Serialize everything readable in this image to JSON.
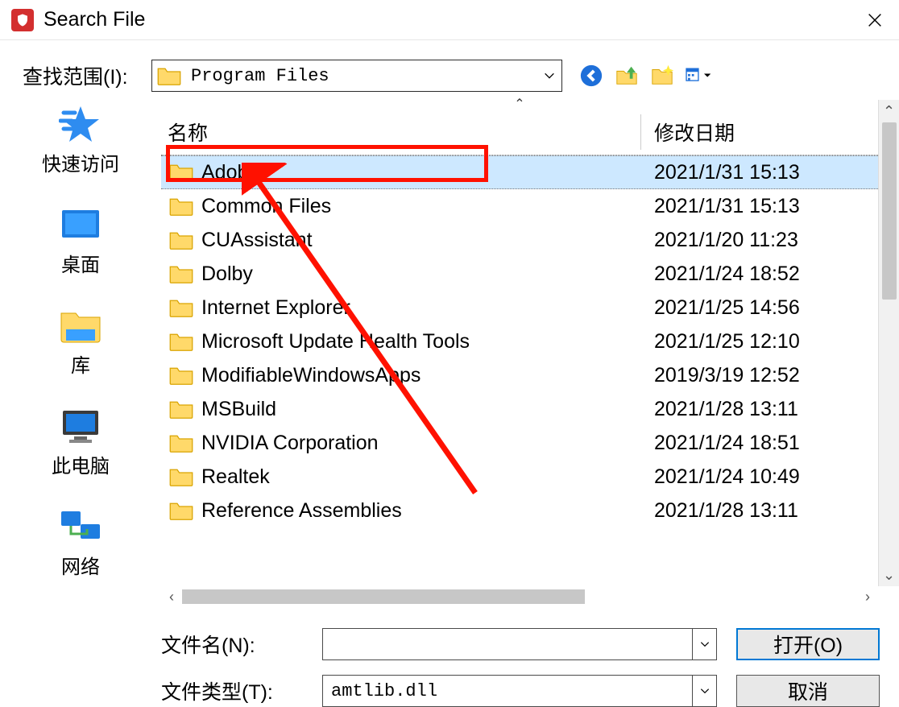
{
  "title": "Search File",
  "range_label": "查找范围(I):",
  "path": "Program Files",
  "headers": {
    "name": "名称",
    "date": "修改日期"
  },
  "files": [
    {
      "name": "Adobe",
      "date": "2021/1/31 15:13",
      "selected": true
    },
    {
      "name": "Common Files",
      "date": "2021/1/31 15:13"
    },
    {
      "name": "CUAssistant",
      "date": "2021/1/20 11:23"
    },
    {
      "name": "Dolby",
      "date": "2021/1/24 18:52"
    },
    {
      "name": "Internet Explorer",
      "date": "2021/1/25 14:56"
    },
    {
      "name": "Microsoft Update Health Tools",
      "date": "2021/1/25 12:10"
    },
    {
      "name": "ModifiableWindowsApps",
      "date": "2019/3/19 12:52"
    },
    {
      "name": "MSBuild",
      "date": "2021/1/28 13:11"
    },
    {
      "name": "NVIDIA Corporation",
      "date": "2021/1/24 18:51"
    },
    {
      "name": "Realtek",
      "date": "2021/1/24 10:49"
    },
    {
      "name": "Reference Assemblies",
      "date": "2021/1/28 13:11"
    }
  ],
  "sidebar": [
    {
      "label": "快速访问"
    },
    {
      "label": "桌面"
    },
    {
      "label": "库"
    },
    {
      "label": "此电脑"
    },
    {
      "label": "网络"
    }
  ],
  "filename_label": "文件名(N):",
  "filename_value": "",
  "filetype_label": "文件类型(T):",
  "filetype_value": "amtlib.dll",
  "open_btn": "打开(O)",
  "cancel_btn": "取消"
}
